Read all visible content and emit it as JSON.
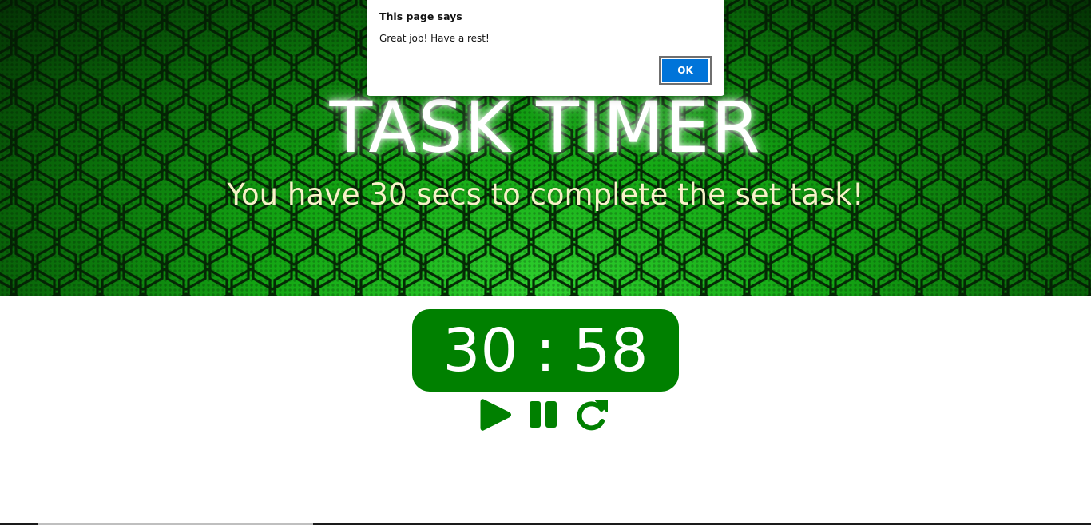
{
  "hero": {
    "title": "TASK TIMER",
    "subtitle": "You have 30 secs to complete the set task!"
  },
  "timer": {
    "left_value": "30",
    "separator": ":",
    "right_value": "58"
  },
  "controls": {
    "play_icon": "play-icon",
    "pause_icon": "pause-icon",
    "reset_icon": "redo-icon"
  },
  "dialog": {
    "title": "This page says",
    "message": "Great job! Have a rest!",
    "ok_label": "OK"
  },
  "colors": {
    "accent_green": "#008000",
    "dialog_button_blue": "#0074d9",
    "subtitle_cream": "#f7f2c8"
  }
}
